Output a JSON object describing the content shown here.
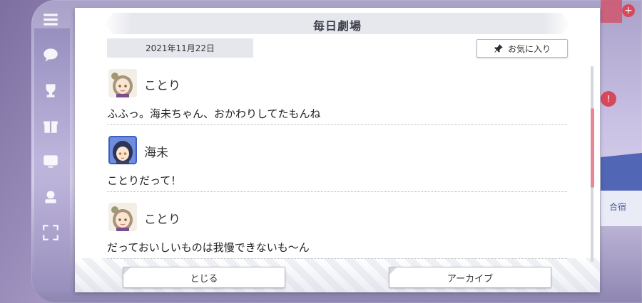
{
  "dialog": {
    "title": "毎日劇場",
    "date": "2021年11月22日",
    "favorite_label": "お気に入り",
    "close_label": "とじる",
    "archive_label": "アーカイブ"
  },
  "messages": [
    {
      "speaker": "ことり",
      "text": "ふふっ。海未ちゃん、おかわりしてたもんね"
    },
    {
      "speaker": "海未",
      "text": "ことりだって！"
    },
    {
      "speaker": "ことり",
      "text": "だっておいしいものは我慢できないも〜ん"
    }
  ],
  "background": {
    "right_tile_label": "合宿"
  },
  "colors": {
    "scroll_thumb": "#e48896",
    "dialog_bg": "#ffffff",
    "title_bar": "#e7e8ee"
  },
  "icons": [
    "menu-icon",
    "chat-icon",
    "trophy-icon",
    "gift-icon",
    "screen-icon",
    "stamp-icon",
    "expand-icon",
    "pin-icon"
  ]
}
